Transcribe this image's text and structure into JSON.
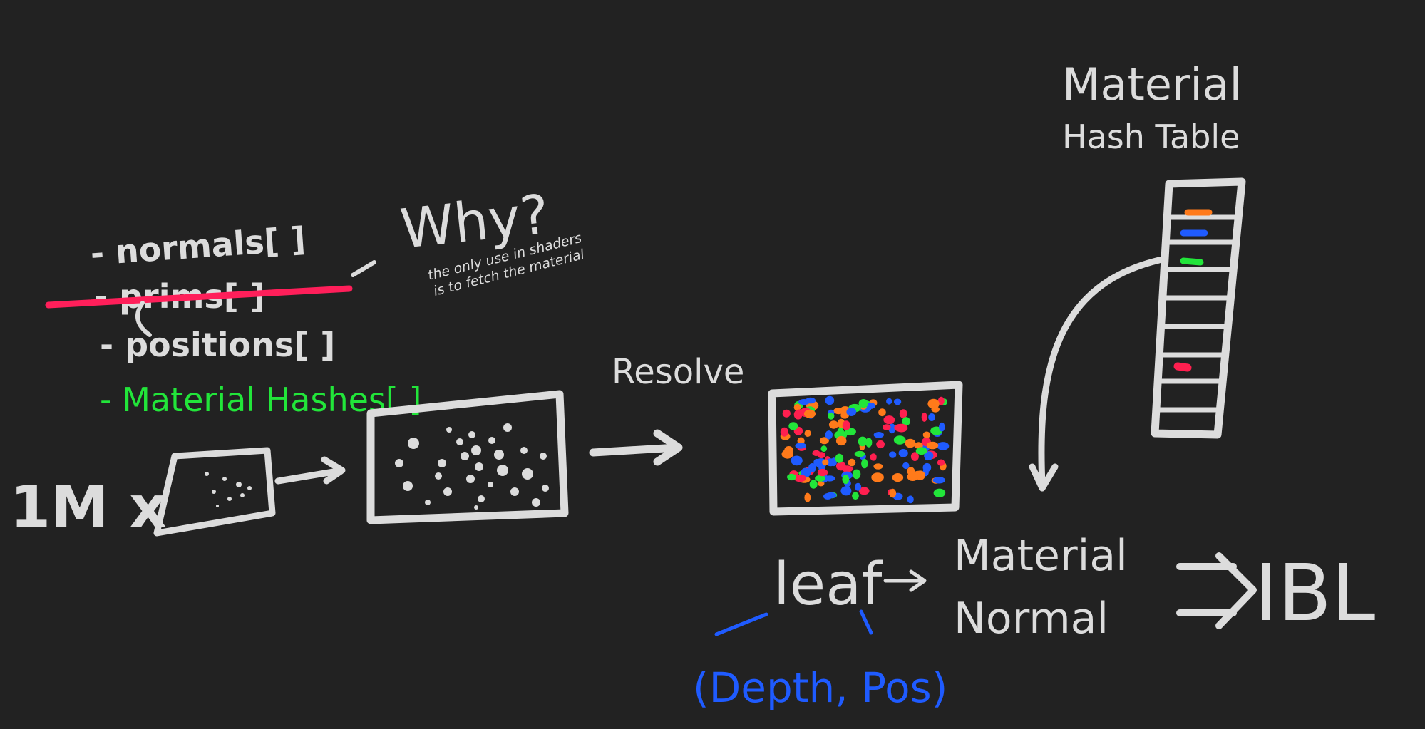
{
  "list": {
    "normals": "- normals[ ]",
    "prims": "- prims[ ]",
    "positions": "- positions[ ]",
    "material_hashes": "- Material Hashes[ ]"
  },
  "question": {
    "why": "Why?",
    "note_line1": "the only use in shaders",
    "note_line2": "is to fetch the material"
  },
  "multiplier": "1M x",
  "resolve_label": "Resolve",
  "hash_table": {
    "title_line1": "Material",
    "title_line2": "Hash Table"
  },
  "leaf": "leaf",
  "leaf_inputs": "(Depth, Pos)",
  "outputs": {
    "line1": "Material",
    "line2": "Normal"
  },
  "ibl": "IBL",
  "colors": {
    "background": "#222222",
    "chalk": "#dcdcdc",
    "strike": "#ff1f5a",
    "green": "#22e53a",
    "blue": "#1f5bff",
    "orange": "#ff7a1a",
    "red": "#ff1f4f"
  }
}
